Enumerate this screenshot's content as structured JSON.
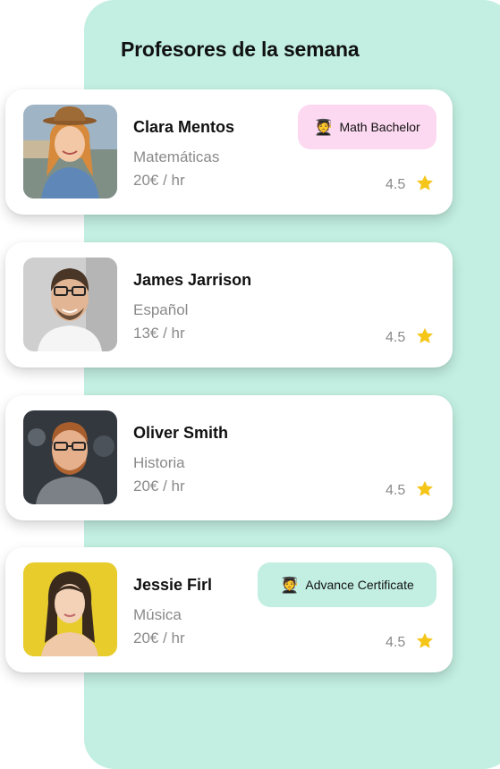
{
  "header": {
    "title": "Profesores de la semana"
  },
  "teachers": [
    {
      "name": "Clara Mentos",
      "subject": "Matemáticas",
      "price": "20€ / hr",
      "rating": "4.5",
      "badge": "Math Bachelor"
    },
    {
      "name": "James Jarrison",
      "subject": "Español",
      "price": "13€ / hr",
      "rating": "4.5"
    },
    {
      "name": "Oliver Smith",
      "subject": "Historia",
      "price": "20€ / hr",
      "rating": "4.5"
    },
    {
      "name": "Jessie Firl",
      "subject": "Música",
      "price": "20€ / hr",
      "rating": "4.5",
      "badge": "Advance Certificate"
    }
  ],
  "icons": {
    "rating": "star-icon",
    "badge": "graduate-icon"
  },
  "colors": {
    "panel": "#c2efe1",
    "badge_pink": "#fcd9f1",
    "badge_mint": "#c2efe1",
    "star": "#f5c518"
  }
}
